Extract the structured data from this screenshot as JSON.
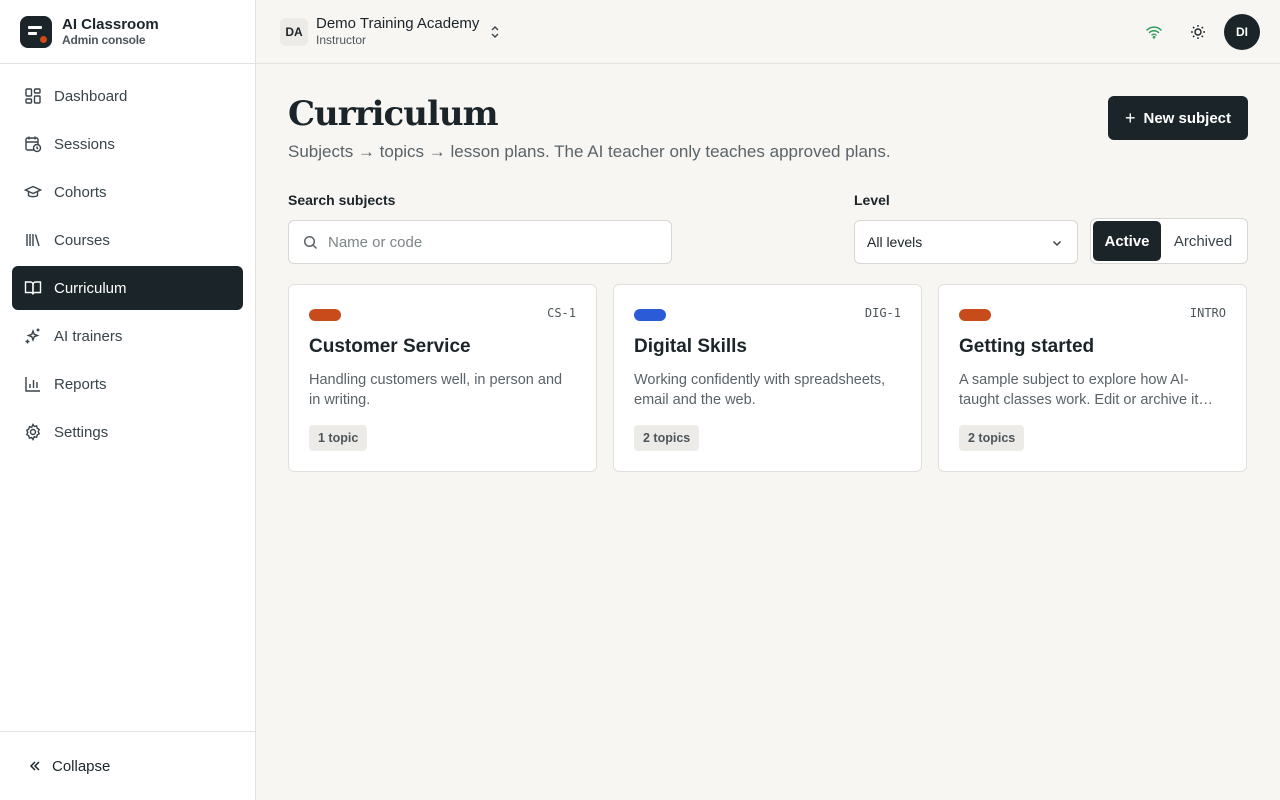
{
  "brand": {
    "title": "AI Classroom",
    "subtitle": "Admin console"
  },
  "sidebar": {
    "items": [
      {
        "label": "Dashboard",
        "icon": "dashboard-icon"
      },
      {
        "label": "Sessions",
        "icon": "calendar-clock-icon"
      },
      {
        "label": "Cohorts",
        "icon": "graduation-cap-icon"
      },
      {
        "label": "Courses",
        "icon": "library-icon"
      },
      {
        "label": "Curriculum",
        "icon": "book-open-icon",
        "active": true
      },
      {
        "label": "AI trainers",
        "icon": "sparkles-icon"
      },
      {
        "label": "Reports",
        "icon": "bar-chart-icon"
      },
      {
        "label": "Settings",
        "icon": "gear-icon"
      }
    ],
    "collapse_label": "Collapse"
  },
  "topbar": {
    "org_initials": "DA",
    "org_name": "Demo Training Academy",
    "org_role": "Instructor",
    "avatar_initials": "DI"
  },
  "page": {
    "title": "Curriculum",
    "subtitle": "Subjects → topics → lesson plans. The AI teacher only teaches approved plans.",
    "new_button": "New subject",
    "search_label": "Search subjects",
    "search_placeholder": "Name or code",
    "level_label": "Level",
    "level_value": "All levels",
    "seg_active": "Active",
    "seg_archived": "Archived"
  },
  "subjects": [
    {
      "code": "CS-1",
      "title": "Customer Service",
      "desc": "Handling customers well, in person and in writing.",
      "count": "1 topic",
      "color": "#c84b1c"
    },
    {
      "code": "DIG-1",
      "title": "Digital Skills",
      "desc": "Working confidently with spreadsheets, email and the web.",
      "count": "2 topics",
      "color": "#2b5bd7"
    },
    {
      "code": "INTRO",
      "title": "Getting started",
      "desc": "A sample subject to explore how AI-taught classes work. Edit or archive it…",
      "count": "2 topics",
      "color": "#c84b1c"
    }
  ],
  "colors": {
    "dark": "#1b2429",
    "accent": "#d04a16",
    "wifi": "#2e9d5b"
  }
}
